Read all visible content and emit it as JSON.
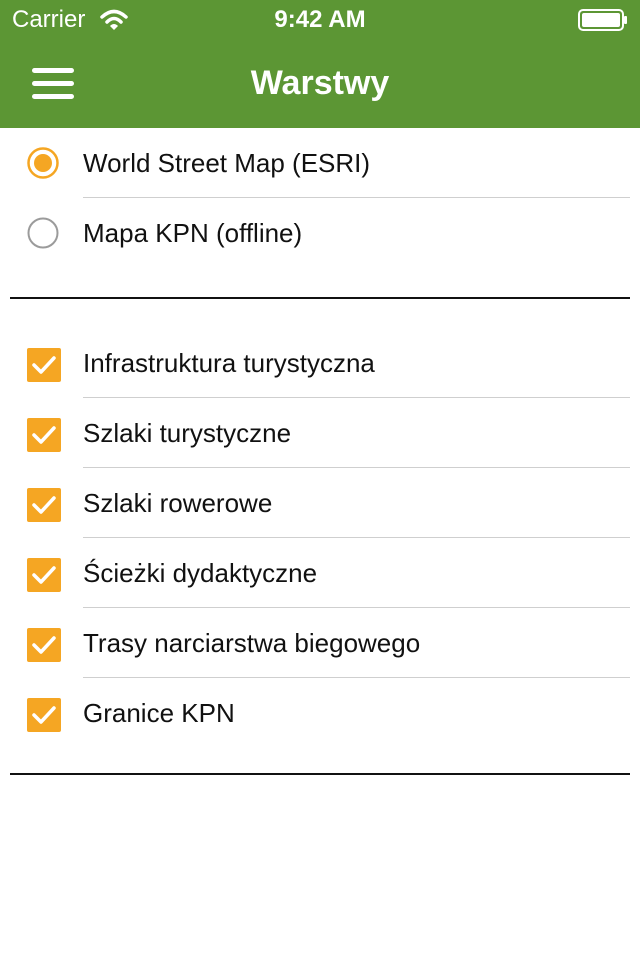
{
  "status_bar": {
    "carrier": "Carrier",
    "time": "9:42 AM"
  },
  "header": {
    "title": "Warstwy"
  },
  "base_layers": [
    {
      "label": "World Street Map (ESRI)",
      "selected": true
    },
    {
      "label": "Mapa KPN (offline)",
      "selected": false
    }
  ],
  "overlay_layers": [
    {
      "label": "Infrastruktura turystyczna",
      "checked": true
    },
    {
      "label": "Szlaki turystyczne",
      "checked": true
    },
    {
      "label": "Szlaki rowerowe",
      "checked": true
    },
    {
      "label": "Ścieżki dydaktyczne",
      "checked": true
    },
    {
      "label": "Trasy narciarstwa biegowego",
      "checked": true
    },
    {
      "label": "Granice KPN",
      "checked": true
    }
  ],
  "colors": {
    "header_bg": "#5c9634",
    "accent": "#f5a623",
    "radio_off": "#9b9b9b"
  }
}
